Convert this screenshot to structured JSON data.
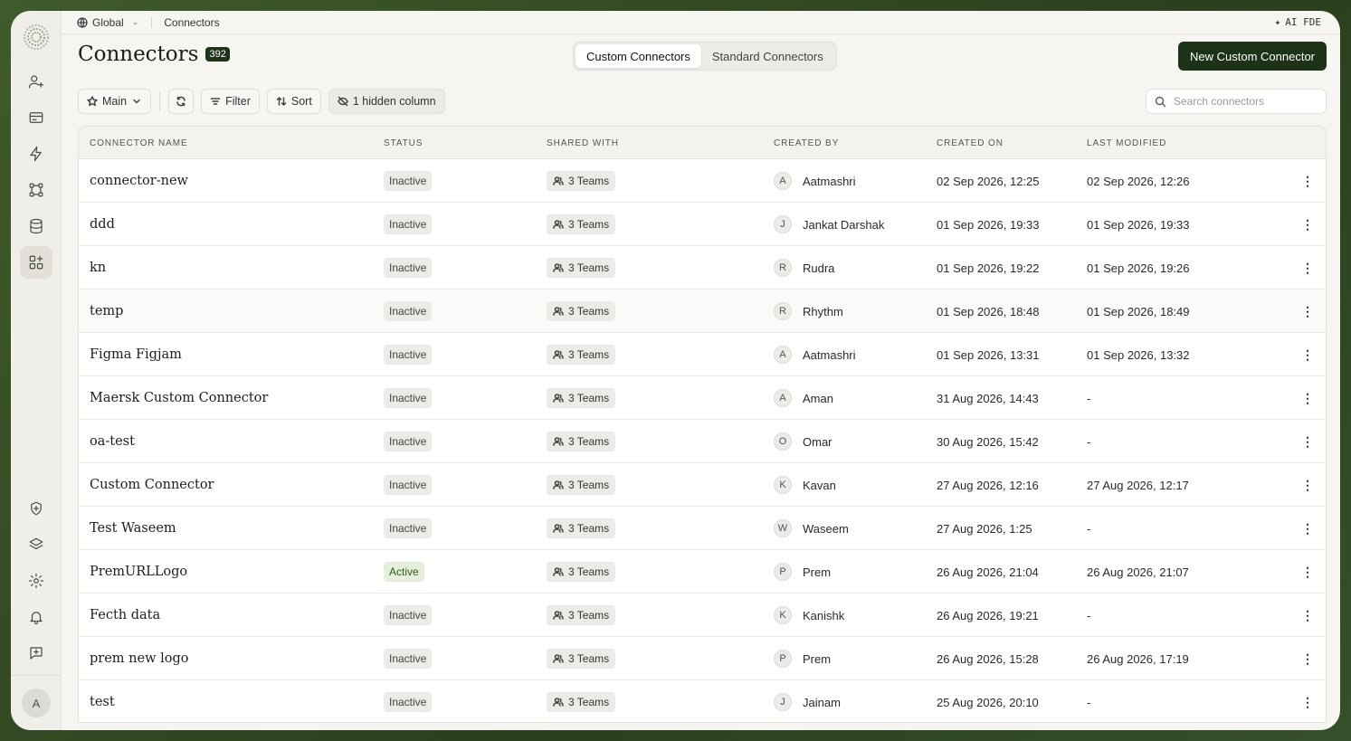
{
  "topbar": {
    "scope": "Global",
    "breadcrumb": "Connectors",
    "ai_label": "AI FDE"
  },
  "header": {
    "title": "Connectors",
    "count": "392",
    "new_button": "New Custom Connector"
  },
  "tabs": [
    {
      "label": "Custom Connectors",
      "active": true
    },
    {
      "label": "Standard Connectors",
      "active": false
    }
  ],
  "toolbar": {
    "view": "Main",
    "filter": "Filter",
    "sort": "Sort",
    "hidden_columns": "1 hidden column"
  },
  "search": {
    "placeholder": "Search connectors"
  },
  "sidebar": {
    "icons": [
      "user-plus-icon",
      "card-icon",
      "bolt-icon",
      "workflow-icon",
      "database-icon",
      "apps-icon"
    ],
    "bottom_icons": [
      "shield-icon",
      "layers-icon",
      "settings-icon",
      "bell-icon",
      "feedback-icon"
    ],
    "avatar": "A"
  },
  "table": {
    "columns": [
      "CONNECTOR NAME",
      "STATUS",
      "SHARED WITH",
      "CREATED BY",
      "CREATED ON",
      "LAST MODIFIED"
    ],
    "rows": [
      {
        "name": "connector-new",
        "status": "Inactive",
        "shared": "3 Teams",
        "initial": "A",
        "by": "Aatmashri",
        "on": "02 Sep 2026, 12:25",
        "mod": "02 Sep 2026, 12:26"
      },
      {
        "name": "ddd",
        "status": "Inactive",
        "shared": "3 Teams",
        "initial": "J",
        "by": "Jankat Darshak",
        "on": "01 Sep 2026, 19:33",
        "mod": "01 Sep 2026, 19:33"
      },
      {
        "name": "kn",
        "status": "Inactive",
        "shared": "3 Teams",
        "initial": "R",
        "by": "Rudra",
        "on": "01 Sep 2026, 19:22",
        "mod": "01 Sep 2026, 19:26"
      },
      {
        "name": "temp",
        "status": "Inactive",
        "shared": "3 Teams",
        "initial": "R",
        "by": "Rhythm",
        "on": "01 Sep 2026, 18:48",
        "mod": "01 Sep 2026, 18:49"
      },
      {
        "name": "Figma Figjam",
        "status": "Inactive",
        "shared": "3 Teams",
        "initial": "A",
        "by": "Aatmashri",
        "on": "01 Sep 2026, 13:31",
        "mod": "01 Sep 2026, 13:32"
      },
      {
        "name": "Maersk Custom Connector",
        "status": "Inactive",
        "shared": "3 Teams",
        "initial": "A",
        "by": "Aman",
        "on": "31 Aug 2026, 14:43",
        "mod": "-"
      },
      {
        "name": "oa-test",
        "status": "Inactive",
        "shared": "3 Teams",
        "initial": "O",
        "by": "Omar",
        "on": "30 Aug 2026, 15:42",
        "mod": "-"
      },
      {
        "name": "Custom Connector",
        "status": "Inactive",
        "shared": "3 Teams",
        "initial": "K",
        "by": "Kavan",
        "on": "27 Aug 2026, 12:16",
        "mod": "27 Aug 2026, 12:17"
      },
      {
        "name": "Test Waseem",
        "status": "Inactive",
        "shared": "3 Teams",
        "initial": "W",
        "by": "Waseem",
        "on": "27 Aug 2026, 1:25",
        "mod": "-"
      },
      {
        "name": "PremURLLogo",
        "status": "Active",
        "shared": "3 Teams",
        "initial": "P",
        "by": "Prem",
        "on": "26 Aug 2026, 21:04",
        "mod": "26 Aug 2026, 21:07"
      },
      {
        "name": "Fecth data",
        "status": "Inactive",
        "shared": "3 Teams",
        "initial": "K",
        "by": "Kanishk",
        "on": "26 Aug 2026, 19:21",
        "mod": "-"
      },
      {
        "name": "prem new logo",
        "status": "Inactive",
        "shared": "3 Teams",
        "initial": "P",
        "by": "Prem",
        "on": "26 Aug 2026, 15:28",
        "mod": "26 Aug 2026, 17:19"
      },
      {
        "name": "test",
        "status": "Inactive",
        "shared": "3 Teams",
        "initial": "J",
        "by": "Jainam",
        "on": "25 Aug 2026, 20:10",
        "mod": "-"
      }
    ]
  }
}
